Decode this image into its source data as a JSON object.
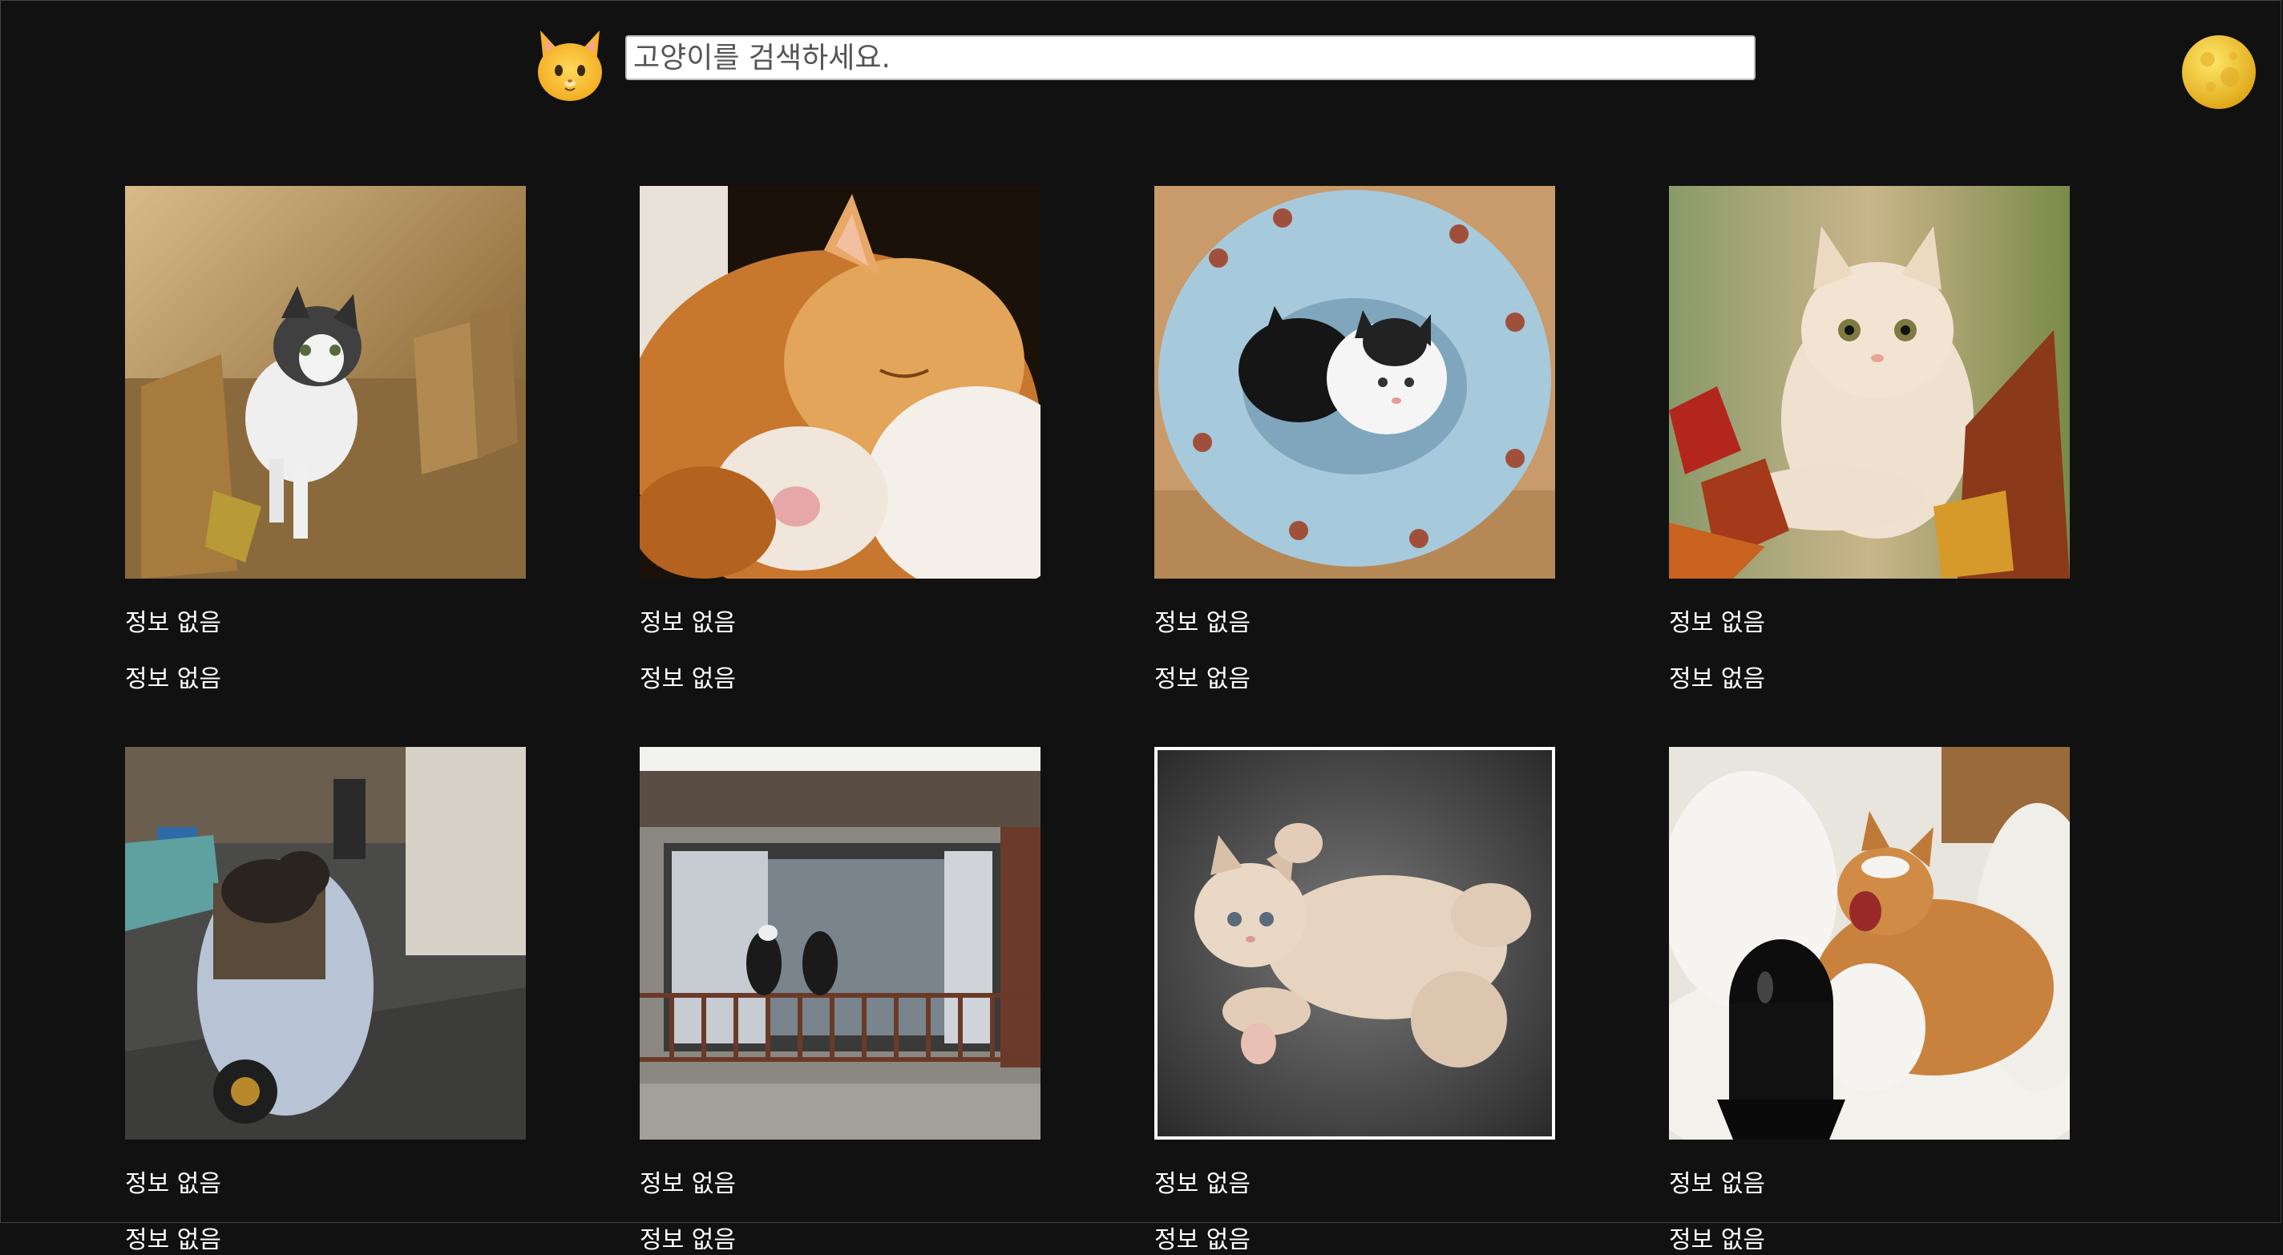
{
  "search": {
    "placeholder": "고양이를 검색하세요."
  },
  "icons": {
    "logo": "cat-face-icon",
    "theme_toggle": "full-moon-icon"
  },
  "colors": {
    "background": "#111111",
    "text": "#ffffff"
  },
  "cards": [
    {
      "line1": "정보 없음",
      "line2": "정보 없음"
    },
    {
      "line1": "정보 없음",
      "line2": "정보 없음"
    },
    {
      "line1": "정보 없음",
      "line2": "정보 없음"
    },
    {
      "line1": "정보 없음",
      "line2": "정보 없음"
    },
    {
      "line1": "정보 없음",
      "line2": "정보 없음"
    },
    {
      "line1": "정보 없음",
      "line2": "정보 없음"
    },
    {
      "line1": "정보 없음",
      "line2": "정보 없음"
    },
    {
      "line1": "정보 없음",
      "line2": "정보 없음"
    }
  ]
}
